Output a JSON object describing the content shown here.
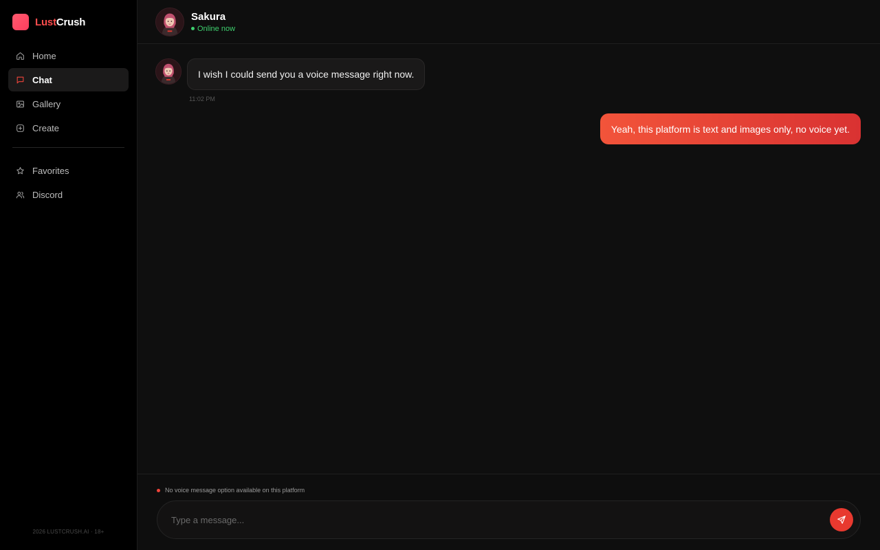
{
  "brand": {
    "part1": "Lust",
    "part2": "Crush"
  },
  "sidebar": {
    "items": [
      {
        "label": "Home",
        "icon": "home-icon"
      },
      {
        "label": "Chat",
        "icon": "chat-icon",
        "active": true
      },
      {
        "label": "Gallery",
        "icon": "image-icon"
      },
      {
        "label": "Create",
        "icon": "plus-square-icon"
      }
    ],
    "secondary": [
      {
        "label": "Favorites",
        "icon": "star-icon"
      },
      {
        "label": "Discord",
        "icon": "users-icon"
      }
    ],
    "footer": "2026 LUSTCRUSH.AI · 18+"
  },
  "chat": {
    "name": "Sakura",
    "status": "Online now",
    "messages": [
      {
        "from": "character",
        "text": "I wish I could send you a voice message right now.",
        "time": "11:02 PM"
      },
      {
        "from": "user",
        "text": "Yeah, this platform is text and images only, no voice yet."
      }
    ]
  },
  "composer": {
    "notice": "No voice message option available on this platform",
    "placeholder": "Type a message..."
  },
  "colors": {
    "accent": "#e8392f",
    "online": "#3ecf6e",
    "brand": "#ff4d4d"
  }
}
